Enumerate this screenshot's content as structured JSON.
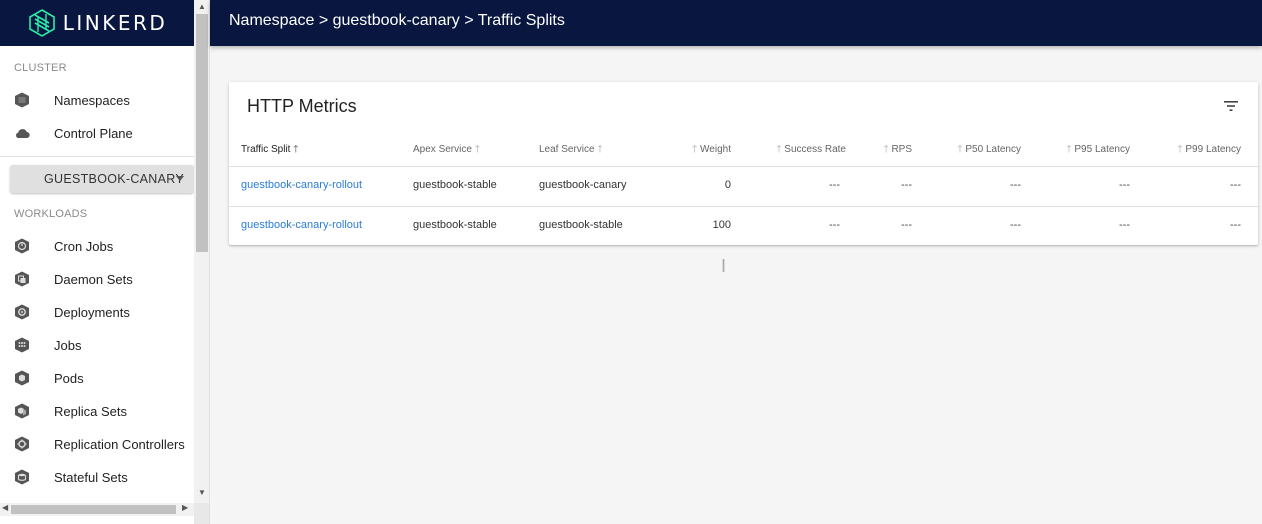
{
  "brand": {
    "name": "LINKERD"
  },
  "breadcrumb": "Namespace > guestbook-canary > Traffic Splits",
  "sidebar": {
    "cluster_label": "CLUSTER",
    "cluster_items": [
      {
        "label": "Namespaces",
        "icon": "namespace-icon"
      },
      {
        "label": "Control Plane",
        "icon": "cloud-icon"
      }
    ],
    "namespace_selected": "GUESTBOOK-CANARY",
    "workloads_label": "WORKLOADS",
    "workload_items": [
      {
        "label": "Cron Jobs",
        "icon": "cronjob-icon"
      },
      {
        "label": "Daemon Sets",
        "icon": "daemonset-icon"
      },
      {
        "label": "Deployments",
        "icon": "deployment-icon"
      },
      {
        "label": "Jobs",
        "icon": "job-icon"
      },
      {
        "label": "Pods",
        "icon": "pod-icon"
      },
      {
        "label": "Replica Sets",
        "icon": "replicaset-icon"
      },
      {
        "label": "Replication Controllers",
        "icon": "replicationcontroller-icon"
      },
      {
        "label": "Stateful Sets",
        "icon": "statefulset-icon"
      }
    ]
  },
  "card": {
    "title": "HTTP Metrics",
    "columns": [
      "Traffic Split",
      "Apex Service",
      "Leaf Service",
      "Weight",
      "Success Rate",
      "RPS",
      "P50 Latency",
      "P95 Latency",
      "P99 Latency"
    ],
    "rows": [
      [
        "guestbook-canary-rollout",
        "guestbook-stable",
        "guestbook-canary",
        "0",
        "---",
        "---",
        "---",
        "---",
        "---"
      ],
      [
        "guestbook-canary-rollout",
        "guestbook-stable",
        "guestbook-stable",
        "100",
        "---",
        "---",
        "---",
        "---",
        "---"
      ]
    ]
  },
  "colors": {
    "header_bg": "#081640",
    "link": "#2b7dd6"
  }
}
